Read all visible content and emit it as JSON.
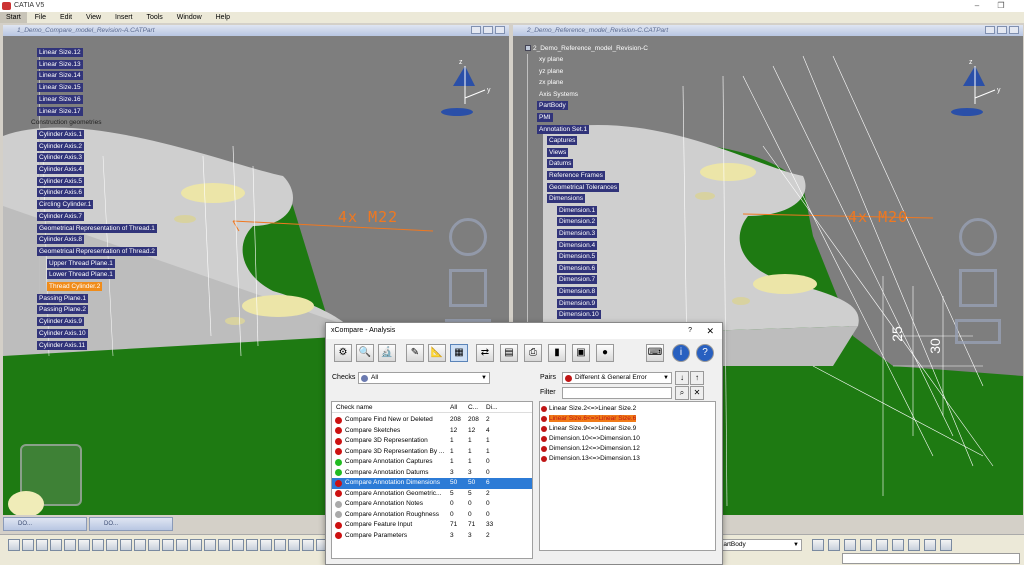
{
  "app": {
    "title": "CATIA V5",
    "menu": [
      "Start",
      "File",
      "Edit",
      "View",
      "Insert",
      "Tools",
      "Window",
      "Help"
    ]
  },
  "left_doc": {
    "title": "1_Demo_Compare_model_Revision-A.CATPart",
    "annotation": "4x  M22",
    "tree": [
      "Linear Size.12",
      "Linear Size.13",
      "Linear Size.14",
      "Linear Size.15",
      "Linear Size.16",
      "Linear Size.17",
      "Construction geometries",
      "Cylinder Axis.1",
      "Cylinder Axis.2",
      "Cylinder Axis.3",
      "Cylinder Axis.4",
      "Cylinder Axis.5",
      "Cylinder Axis.6",
      "Circling Cylinder.1",
      "Cylinder Axis.7",
      "Geometrical Representation of Thread.1",
      "Cylinder Axis.8",
      "Geometrical Representation of Thread.2",
      "Upper Thread Plane.1",
      "Lower Thread Plane.1",
      "Thread Cylinder.2",
      "Passing Plane.1",
      "Passing Plane.2",
      "Cylinder Axis.9",
      "Cylinder Axis.10",
      "Cylinder Axis.11"
    ],
    "tree_selected": "Thread Cylinder.2"
  },
  "right_doc": {
    "title": "2_Demo_Reference_model_Revision-C.CATPart",
    "annotation": "4x  M20",
    "dim_25": "25",
    "dim_30": "30",
    "tree_root": "2_Demo_Reference_model_Revision-C",
    "tree": [
      "xy plane",
      "yz plane",
      "zx plane",
      "Axis Systems",
      "PartBody",
      "PMI",
      "Annotation Set.1",
      "Captures",
      "Views",
      "Datums",
      "Reference Frames",
      "Geometrical Tolerances",
      "Dimensions",
      "Dimension.1",
      "Dimension.2",
      "Dimension.3",
      "Dimension.4",
      "Dimension.5",
      "Dimension.6",
      "Dimension.7",
      "Dimension.8",
      "Dimension.9",
      "Dimension.10"
    ]
  },
  "dialog": {
    "title": "xCompare - Analysis",
    "help": "?",
    "close": "✕",
    "checks_label": "Checks",
    "checks_value": "All",
    "pairs_label": "Pairs",
    "pairs_value": "Different & General Error",
    "filter_label": "Filter",
    "filter_value": "",
    "columns": [
      "Check name",
      "All",
      "C...",
      "Di..."
    ],
    "checks": [
      {
        "name": "Compare Find New or Deleted",
        "all": "208",
        "c": "208",
        "d": "2",
        "status": "#cc1111"
      },
      {
        "name": "Compare Sketches",
        "all": "12",
        "c": "12",
        "d": "4",
        "status": "#cc1111"
      },
      {
        "name": "Compare 3D Representation",
        "all": "1",
        "c": "1",
        "d": "1",
        "status": "#cc1111"
      },
      {
        "name": "Compare 3D Representation By ...",
        "all": "1",
        "c": "1",
        "d": "1",
        "status": "#cc1111"
      },
      {
        "name": "Compare Annotation Captures",
        "all": "1",
        "c": "1",
        "d": "0",
        "status": "#22bb22"
      },
      {
        "name": "Compare Annotation Datums",
        "all": "3",
        "c": "3",
        "d": "0",
        "status": "#22bb22"
      },
      {
        "name": "Compare Annotation Dimensions",
        "all": "50",
        "c": "50",
        "d": "6",
        "status": "#cc1111"
      },
      {
        "name": "Compare Annotation Geometric...",
        "all": "5",
        "c": "5",
        "d": "2",
        "status": "#cc1111"
      },
      {
        "name": "Compare Annotation Notes",
        "all": "0",
        "c": "0",
        "d": "0",
        "status": "#aaaaaa"
      },
      {
        "name": "Compare Annotation Roughness",
        "all": "0",
        "c": "0",
        "d": "0",
        "status": "#aaaaaa"
      },
      {
        "name": "Compare Feature Input",
        "all": "71",
        "c": "71",
        "d": "33",
        "status": "#cc1111"
      },
      {
        "name": "Compare Parameters",
        "all": "3",
        "c": "3",
        "d": "2",
        "status": "#cc1111"
      }
    ],
    "selected_check": 6,
    "pairs": [
      "Linear Size.2<=>Linear Size.2",
      "Linear Size.6<=>Linear Size.6",
      "Linear Size.9<=>Linear Size.9",
      "Dimension.10<=>Dimension.10",
      "Dimension.12<=>Dimension.12",
      "Dimension.13<=>Dimension.13"
    ],
    "selected_pair": 1
  },
  "taskbar": {
    "min_windows": [
      "DO...",
      "DO..."
    ],
    "body_combo": "PartBody"
  },
  "colors": {
    "tree_highlight": "#31347a",
    "selection": "#f08c1a",
    "green_part": "#1e7a12",
    "grey_part": "#c8c8c8",
    "annotation": "#f07820",
    "dialog_selection": "#2c7bd6"
  }
}
